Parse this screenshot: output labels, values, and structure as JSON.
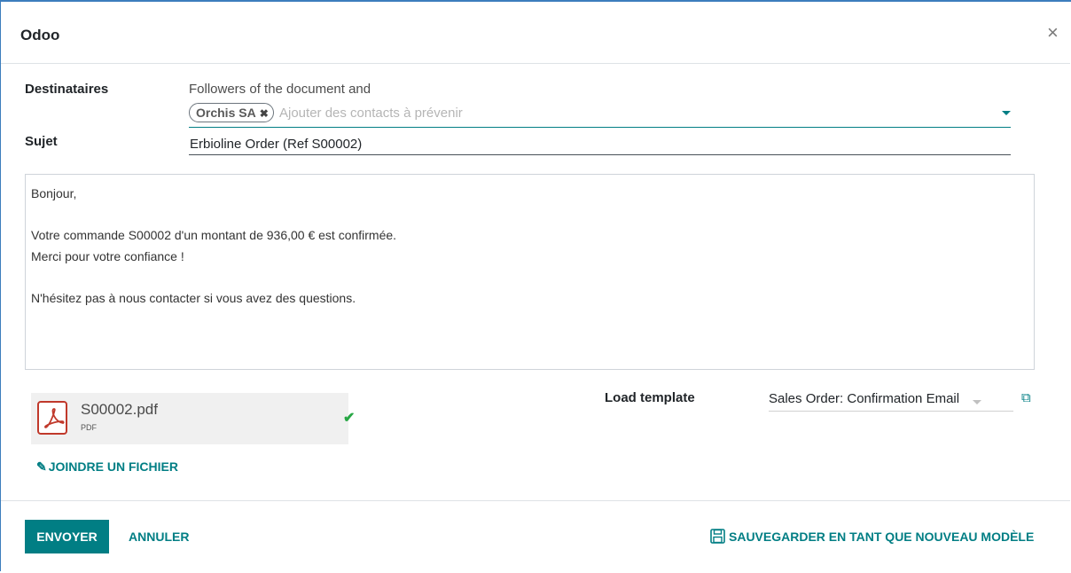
{
  "dialog": {
    "title": "Odoo",
    "close_symbol": "×"
  },
  "form": {
    "recipients_label": "Destinataires",
    "followers_text": "Followers of the document and",
    "recipient_tags": [
      {
        "name": "Orchis SA",
        "remove_symbol": "✖"
      }
    ],
    "recipients_placeholder": "Ajouter des contacts à prévenir",
    "subject_label": "Sujet",
    "subject_value": "Erbioline Order (Ref S00002)"
  },
  "body": {
    "lines": [
      "Bonjour,",
      "",
      "Votre commande S00002 d'un montant de 936,00 € est confirmée.",
      "Merci pour votre confiance !",
      "",
      "N'hésitez pas à nous contacter si vous avez des questions."
    ]
  },
  "attachment": {
    "file_name": "S00002.pdf",
    "file_type": "PDF",
    "icon": "pdf-file-icon",
    "status_icon": "check-icon",
    "status_symbol": "✔",
    "status_color": "#28a745"
  },
  "attach_link": {
    "icon": "paperclip-icon",
    "icon_symbol": "✎",
    "label": "JOINDRE UN FICHIER"
  },
  "template": {
    "label": "Load template",
    "selected": "Sales Order: Confirmation Email",
    "external_icon": "external-link-icon",
    "external_symbol": "⧉"
  },
  "footer": {
    "send_label": "ENVOYER",
    "cancel_label": "ANNULER",
    "save_template_label": "SAUVEGARDER EN TANT QUE NOUVEAU MODÈLE",
    "save_icon": "floppy-disk-icon"
  },
  "colors": {
    "primary": "#017e84",
    "pdf_red": "#c0392b"
  }
}
